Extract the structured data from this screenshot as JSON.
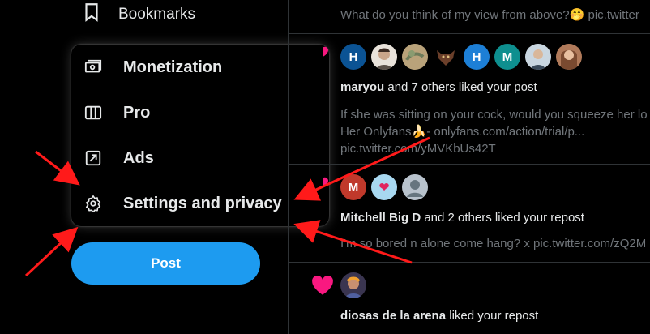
{
  "sidebar": {
    "bookmarks_label": "Bookmarks",
    "menu": [
      {
        "label": "Monetization",
        "icon": "monetization-icon"
      },
      {
        "label": "Pro",
        "icon": "columns-icon"
      },
      {
        "label": "Ads",
        "icon": "ads-arrow-icon"
      },
      {
        "label": "Settings and privacy",
        "icon": "gear-icon"
      }
    ],
    "post_label": "Post"
  },
  "feed": {
    "top_preview": "What do you think of my view from above?🤭 pic.twitter",
    "notifications": [
      {
        "avatars": [
          {
            "letter": "H",
            "color": "#0b5394"
          },
          {
            "letter": "",
            "color": "#e8e2da"
          },
          {
            "letter": "",
            "color": "#b9a27a"
          },
          {
            "letter": "",
            "color": "#6b3f2a"
          },
          {
            "letter": "H",
            "color": "#1d7fd6"
          },
          {
            "letter": "M",
            "color": "#0e8f8f"
          },
          {
            "letter": "",
            "color": "#c9b6a0"
          },
          {
            "letter": "",
            "color": "#b07a5a"
          }
        ],
        "actor": "maryou",
        "rest": " and 7 others liked your post",
        "preview_lines": [
          "If she was sitting on your cock, would you squeeze her lo",
          "Her Onlyfans🍌- onlyfans.com/action/trial/p...",
          "pic.twitter.com/yMVKbUs42T"
        ]
      },
      {
        "avatars": [
          {
            "letter": "M",
            "color": "#c0392b"
          },
          {
            "letter": "❤",
            "color": "#a8d8f0"
          },
          {
            "letter": "",
            "color": "#b8c2cc"
          }
        ],
        "actor": "Mitchell Big D",
        "rest": " and 2 others liked your repost",
        "preview_lines": [
          "I'm so bored n alone come hang? x pic.twitter.com/zQ2M"
        ]
      },
      {
        "avatars": [
          {
            "letter": "",
            "color": "#3a3550"
          }
        ],
        "actor": "diosas de la arena",
        "rest": " liked your repost",
        "preview_lines": []
      }
    ]
  },
  "colors": {
    "accent": "#1d9bf0",
    "heart": "#f91880",
    "annotation": "#ff1a1a"
  }
}
